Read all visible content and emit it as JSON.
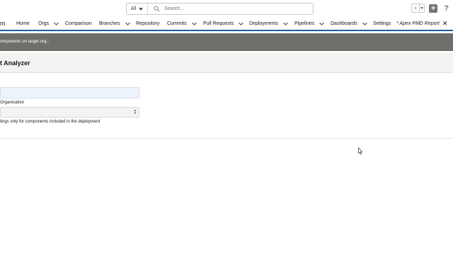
{
  "search": {
    "scope": "All",
    "placeholder": "Search..."
  },
  "nav": {
    "app_name": "m",
    "items": [
      {
        "label": "Home"
      },
      {
        "label": "Orgs"
      },
      {
        "label": "Comparison"
      },
      {
        "label": "Branches"
      },
      {
        "label": "Repository"
      },
      {
        "label": "Commits"
      },
      {
        "label": "Pull Requests"
      },
      {
        "label": "Deployments"
      },
      {
        "label": "Pipelines"
      },
      {
        "label": "Dashboards"
      },
      {
        "label": "Settings"
      }
    ],
    "active_tab": "* Apex PMD Report",
    "close_glyph": "✕"
  },
  "banner": {
    "text": "omponents on target org..."
  },
  "page": {
    "title": "t Analyzer"
  },
  "form": {
    "org_label": "Organisation",
    "hint": "tings only for components included in the deployment"
  }
}
